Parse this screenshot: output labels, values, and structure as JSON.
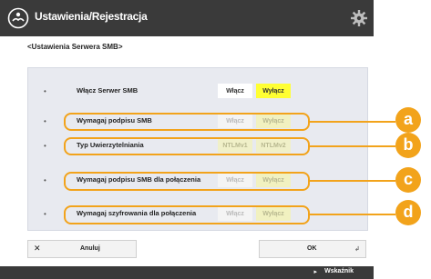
{
  "header": {
    "title": "Ustawienia/Rejestracja",
    "home_icon": "home-icon",
    "settings_icon": "gear-icon"
  },
  "breadcrumb": "<Ustawienia Serwera SMB>",
  "rows": [
    {
      "label": "Włącz Serwer SMB",
      "options": [
        "Włącz",
        "Wyłącz"
      ],
      "selected": "Wyłącz",
      "enabled": true
    },
    {
      "label": "Wymagaj podpisu SMB",
      "options": [
        "Włącz",
        "Wyłącz"
      ],
      "selected": "Wyłącz",
      "enabled": false
    },
    {
      "label": "Typ Uwierzytelniania",
      "options": [
        "NTLMv1",
        "NTLMv2"
      ],
      "selected": null,
      "enabled": false
    },
    {
      "label": "Wymagaj podpisu SMB dla połączenia",
      "options": [
        "Włącz",
        "Wyłącz"
      ],
      "selected": "Wyłącz",
      "enabled": false
    },
    {
      "label": "Wymagaj szyfrowania dla połączenia",
      "options": [
        "Włącz",
        "Wyłącz"
      ],
      "selected": "Wyłącz",
      "enabled": false
    }
  ],
  "callouts": [
    "a",
    "b",
    "c",
    "d"
  ],
  "footer": {
    "cancel_label": "Anuluj",
    "ok_label": "OK"
  },
  "statusbar": {
    "label": "Wskaźnik"
  },
  "colors": {
    "titlebar": "#3a3a3a",
    "selected_option": "#ffff33",
    "callout": "#f2a31b",
    "panel": "#e8eaf0"
  }
}
